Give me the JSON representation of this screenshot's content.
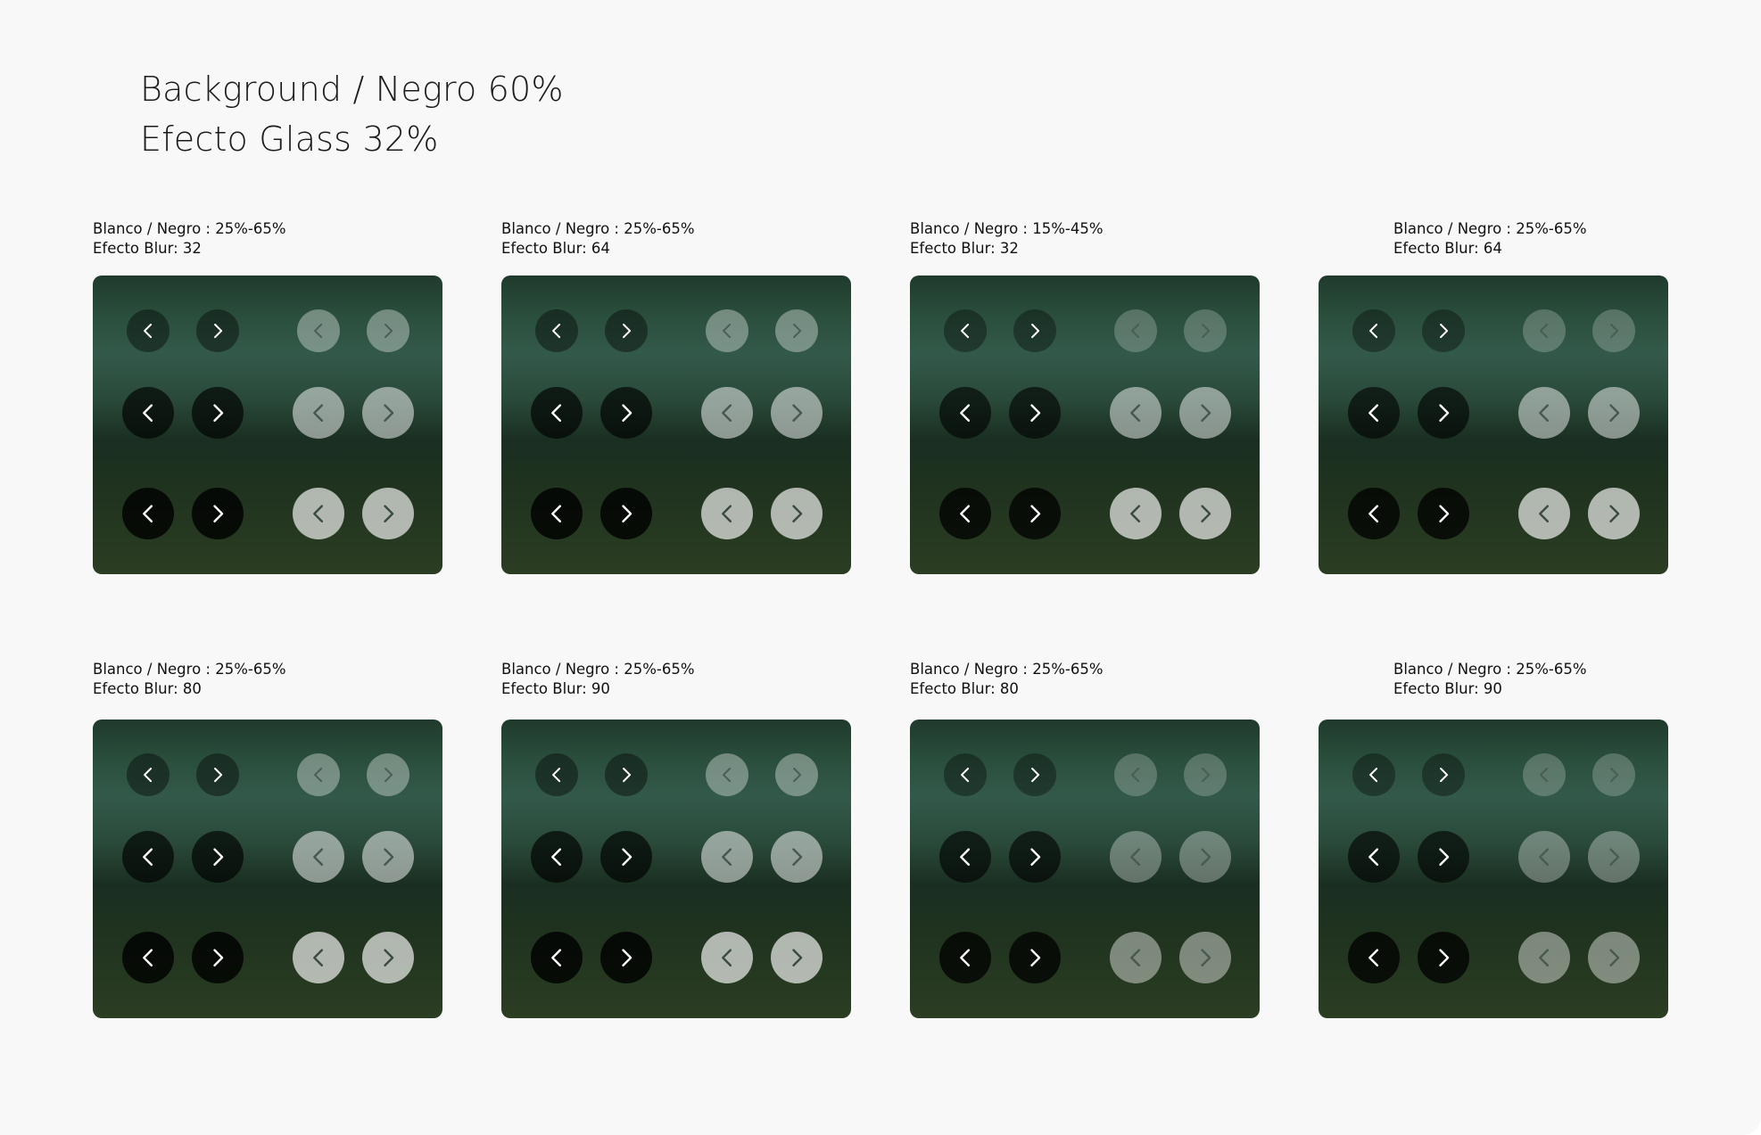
{
  "header": {
    "line1": "Background / Negro 60%",
    "line2": "Efecto Glass 32%"
  },
  "colors": {
    "page_background": "#f8f8f8",
    "panel_gradient": [
      "#1f3a2c",
      "#33594a",
      "#1a2f22",
      "#2b3d22"
    ],
    "dark_button": "#000000",
    "light_button": "#ffffff",
    "dark_chevron": "#ffffff",
    "light_chevron": "#3a4a40"
  },
  "variants": [
    {
      "label": "Blanco / Negro : 25%-65%",
      "blur": "Efecto Blur: 32",
      "dark_levels": [
        0.4,
        0.65,
        0.8
      ],
      "light_levels": [
        0.35,
        0.5,
        0.65
      ]
    },
    {
      "label": "Blanco / Negro : 25%-65%",
      "blur": "Efecto Blur: 64",
      "dark_levels": [
        0.4,
        0.65,
        0.8
      ],
      "light_levels": [
        0.35,
        0.5,
        0.65
      ]
    },
    {
      "label": "Blanco / Negro : 15%-45%",
      "blur": "Efecto Blur: 32",
      "dark_levels": [
        0.35,
        0.6,
        0.75
      ],
      "light_levels": [
        0.22,
        0.48,
        0.65
      ]
    },
    {
      "label": "Blanco / Negro : 25%-65%",
      "blur": "Efecto Blur: 64",
      "dark_levels": [
        0.35,
        0.6,
        0.75
      ],
      "light_levels": [
        0.22,
        0.48,
        0.65
      ]
    },
    {
      "label": "Blanco / Negro : 25%-65%",
      "blur": "Efecto Blur: 80",
      "dark_levels": [
        0.4,
        0.65,
        0.8
      ],
      "light_levels": [
        0.35,
        0.5,
        0.65
      ]
    },
    {
      "label": "Blanco / Negro : 25%-65%",
      "blur": "Efecto Blur: 90",
      "dark_levels": [
        0.4,
        0.65,
        0.8
      ],
      "light_levels": [
        0.35,
        0.5,
        0.65
      ]
    },
    {
      "label": "Blanco / Negro : 25%-65%",
      "blur": "Efecto Blur: 80",
      "dark_levels": [
        0.35,
        0.6,
        0.75
      ],
      "light_levels": [
        0.22,
        0.32,
        0.42
      ]
    },
    {
      "label": "Blanco / Negro : 25%-65%",
      "blur": "Efecto Blur: 90",
      "dark_levels": [
        0.35,
        0.6,
        0.75
      ],
      "light_levels": [
        0.22,
        0.32,
        0.42
      ]
    }
  ]
}
